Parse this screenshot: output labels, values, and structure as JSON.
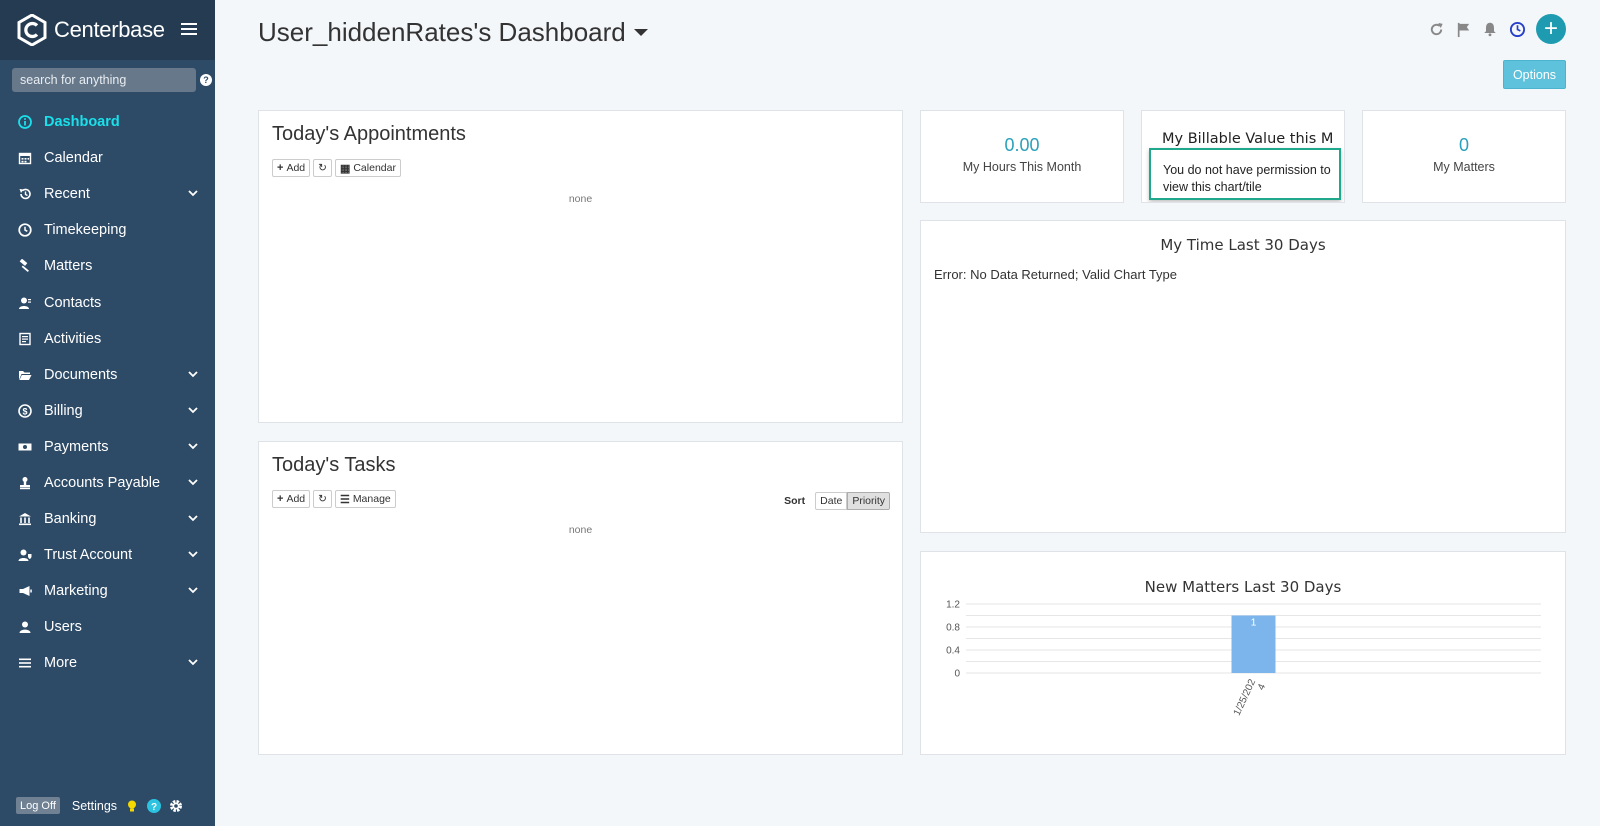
{
  "app": {
    "name": "Centerbase"
  },
  "search": {
    "placeholder": "search for anything"
  },
  "sidebar": {
    "items": [
      {
        "label": "Dashboard",
        "icon": "info-icon",
        "active": true,
        "expandable": false
      },
      {
        "label": "Calendar",
        "icon": "calendar-icon",
        "active": false,
        "expandable": false
      },
      {
        "label": "Recent",
        "icon": "history-icon",
        "active": false,
        "expandable": true
      },
      {
        "label": "Timekeeping",
        "icon": "clock-icon",
        "active": false,
        "expandable": false
      },
      {
        "label": "Matters",
        "icon": "gavel-icon",
        "active": false,
        "expandable": false
      },
      {
        "label": "Contacts",
        "icon": "contacts-icon",
        "active": false,
        "expandable": false
      },
      {
        "label": "Activities",
        "icon": "activities-icon",
        "active": false,
        "expandable": false
      },
      {
        "label": "Documents",
        "icon": "folder-icon",
        "active": false,
        "expandable": true
      },
      {
        "label": "Billing",
        "icon": "dollar-circle-icon",
        "active": false,
        "expandable": true
      },
      {
        "label": "Payments",
        "icon": "money-icon",
        "active": false,
        "expandable": true
      },
      {
        "label": "Accounts Payable",
        "icon": "stamp-icon",
        "active": false,
        "expandable": true
      },
      {
        "label": "Banking",
        "icon": "bank-icon",
        "active": false,
        "expandable": true
      },
      {
        "label": "Trust Account",
        "icon": "trust-icon",
        "active": false,
        "expandable": true
      },
      {
        "label": "Marketing",
        "icon": "megaphone-icon",
        "active": false,
        "expandable": true
      },
      {
        "label": "Users",
        "icon": "user-icon",
        "active": false,
        "expandable": false
      },
      {
        "label": "More",
        "icon": "list-icon",
        "active": false,
        "expandable": true
      }
    ],
    "footer": {
      "logoff_label": "Log Off",
      "settings_label": "Settings"
    }
  },
  "header": {
    "title": "User_hiddenRates's Dashboard",
    "options_label": "Options"
  },
  "appointments": {
    "title": "Today's Appointments",
    "add_label": "Add",
    "calendar_label": "Calendar",
    "empty_text": "none"
  },
  "tasks": {
    "title": "Today's Tasks",
    "add_label": "Add",
    "manage_label": "Manage",
    "sort_label": "Sort",
    "sort_date_label": "Date",
    "sort_priority_label": "Priority",
    "empty_text": "none"
  },
  "kpis": {
    "hours": {
      "value": "0.00",
      "label": "My Hours This Month"
    },
    "billable": {
      "title": "My Billable Value this M",
      "message": "You do not have permission to view this chart/tile"
    },
    "matters": {
      "value": "0",
      "label": "My Matters"
    }
  },
  "time_chart": {
    "title": "My Time Last 30 Days",
    "error": "Error: No Data Returned; Valid Chart Type"
  },
  "chart_data": {
    "type": "bar",
    "title": "New Matters Last 30 Days",
    "categories": [
      "1/25/2024"
    ],
    "category_label_lines": [
      "1/25/202",
      "4"
    ],
    "values": [
      1
    ],
    "data_labels": [
      "1"
    ],
    "ylim": [
      0,
      1.2
    ],
    "yticks": [
      0,
      0.4,
      0.8,
      1.2
    ],
    "ytick_labels": [
      "0",
      "0.4",
      "0.8",
      "1.2"
    ],
    "grid": true,
    "bar_color": "#7cb5ec"
  },
  "colors": {
    "sidebar": "#2d4a66",
    "accent": "#19e0ea",
    "primary": "#1e9bb0",
    "highlight_border": "#1fa88c"
  }
}
